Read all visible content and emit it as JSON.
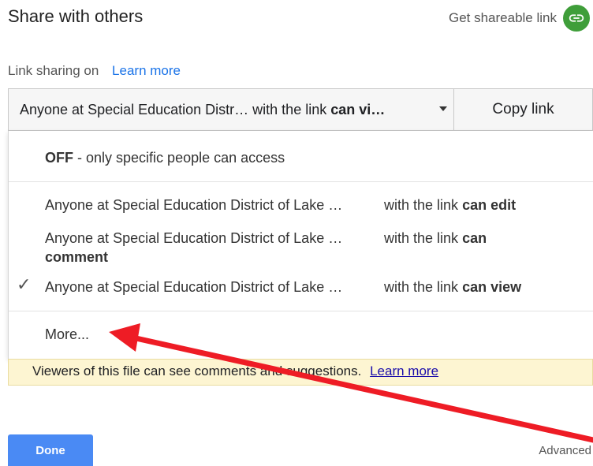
{
  "dialog": {
    "title": "Share with others",
    "get_link_label": "Get shareable link",
    "get_link_icon": "link-icon",
    "accent_green": "#3f9e3a"
  },
  "sharing": {
    "status": "Link sharing on",
    "learn_more": "Learn more"
  },
  "dropdown": {
    "selected_org": "Anyone at Special Education Distr…",
    "selected_mid": "with the link",
    "selected_bold": "can vi…",
    "copy_label": "Copy link"
  },
  "menu": {
    "off_bold": "OFF",
    "off_text": "- only specific people can access",
    "items": [
      {
        "org": "Anyone at Special Education District of Lake …",
        "mid": "with the link",
        "bold": "can edit",
        "checked": false
      },
      {
        "org": "Anyone at Special Education District of Lake …",
        "mid": "with the link",
        "bold": "can",
        "bold2": "comment",
        "checked": false
      },
      {
        "org": "Anyone at Special Education District of Lake …",
        "mid": "with the link",
        "bold": "can view",
        "checked": true
      }
    ],
    "more": "More..."
  },
  "info": {
    "text": "Viewers of this file can see comments and suggestions.",
    "link": "Learn more"
  },
  "footer": {
    "done": "Done",
    "advanced": "Advanced"
  },
  "annotation": {
    "arrow_color": "#ee1c25"
  }
}
